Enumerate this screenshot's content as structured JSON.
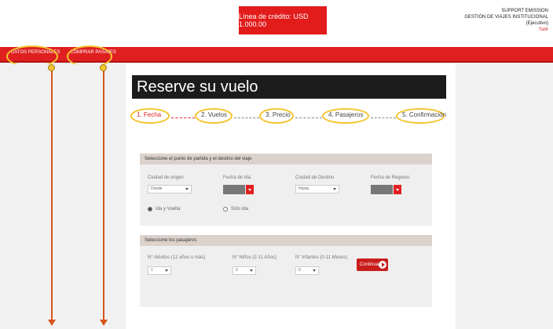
{
  "header": {
    "credit_text": "Línea de crédito: USD 1.000.00",
    "user_lines": [
      "SUPPORT EMISSION",
      "GESTIÓN DE VIAJES INSTITUCIONAL",
      "(Ejecutivo)"
    ],
    "logout": "Salir"
  },
  "nav": {
    "items": [
      {
        "label": "DATOS PERSONALES"
      },
      {
        "label": "COMPRAR PASAJES"
      }
    ],
    "highlight_color": "#f3c52e"
  },
  "main": {
    "title": "Reserve su vuelo",
    "steps": [
      {
        "label": "1. Fecha",
        "active": true
      },
      {
        "label": "2. Vuelos",
        "active": false
      },
      {
        "label": "3. Precio",
        "active": false
      },
      {
        "label": "4. Pasajeros",
        "active": false
      },
      {
        "label": "5. Confirmación",
        "active": false
      }
    ],
    "route_section": {
      "header": "Seleccione el punto de partida y el destino del viaje",
      "origin_label": "Ciudad de origen",
      "origin_value": "Desde",
      "departure_label": "Fecha de Ida",
      "destination_label": "Ciudad de Destino",
      "destination_value": "Hasta",
      "return_label": "Fecha de Regreso",
      "round_trip_label": "Ida y Vuelta",
      "one_way_label": "Sólo Ida"
    },
    "passengers_section": {
      "header": "Seleccione los pasajeros",
      "adults_label": "N° Adultos (12 años o más)",
      "adults_value": "1",
      "children_label": "N° Niños (2-11 Años)",
      "children_value": "0",
      "infants_label": "N° Infantes (0-11 Meses)",
      "infants_value": "0",
      "continue_label": "Continuar"
    }
  },
  "colors": {
    "brand_red": "#e02020",
    "annotation": "#f3c52e",
    "arrow": "#d8561b"
  }
}
